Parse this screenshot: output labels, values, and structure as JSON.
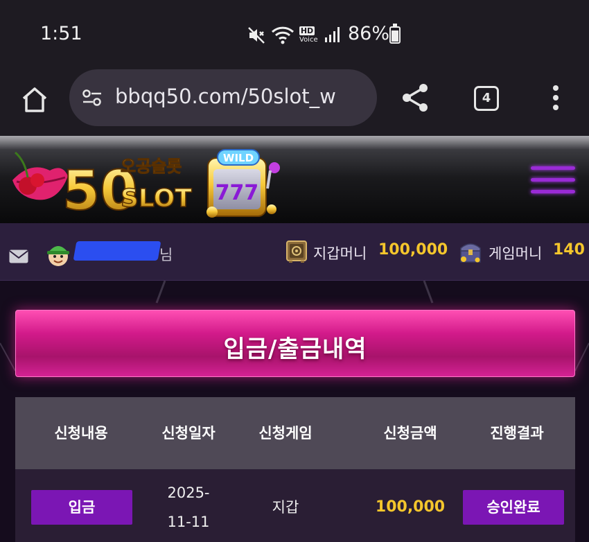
{
  "status_bar": {
    "time": "1:51",
    "battery": "86%",
    "network_label_hd": "HD",
    "network_label_voice": "Voice"
  },
  "browser": {
    "url": "bbqq50.com/50slot_w",
    "tab_count": "4"
  },
  "site": {
    "logo_text": "50SLOT",
    "logo_korean": "오공슬롯",
    "logo_reel_badge": "WILD",
    "logo_reel_symbols": "777"
  },
  "user_bar": {
    "username_suffix": "님",
    "wallet_label": "지갑머니",
    "wallet_value": "100,000",
    "game_money_label": "게임머니",
    "game_money_value": "140"
  },
  "page": {
    "title": "입금/출금내역"
  },
  "table": {
    "headers": [
      "신청내용",
      "신청일자",
      "신청게임",
      "신청금액",
      "진행결과"
    ],
    "rows": [
      {
        "type": "입금",
        "date": "2025-11-11",
        "game": "지갑",
        "amount": "100,000",
        "result": "승인완료"
      }
    ]
  },
  "colors": {
    "accent_purple": "#7b16b4",
    "banner_pink": "#d21a8a",
    "money_gold": "#f4c62c"
  },
  "icons": {
    "status": [
      "mute-icon",
      "wifi-icon",
      "signal-icon",
      "battery-icon"
    ],
    "browser": [
      "home-icon",
      "site-settings-icon",
      "share-icon",
      "tabs-icon",
      "more-vert-icon"
    ],
    "site": [
      "hamburger-icon",
      "mail-icon",
      "avatar-icon",
      "safe-icon",
      "treasure-chest-icon"
    ]
  }
}
